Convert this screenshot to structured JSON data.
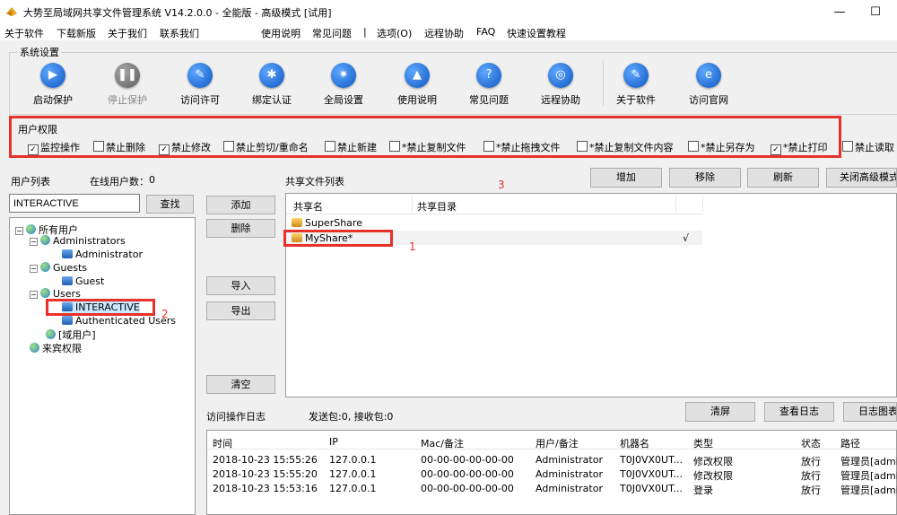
{
  "window": {
    "title": "大势至局域网共享文件管理系统 V14.2.0.0 - 全能版 - 高级模式 [试用]",
    "minimize": "—",
    "maximize": "☐"
  },
  "menu": {
    "about_software": "关于软件",
    "download": "下载新版",
    "about_us": "关于我们",
    "contact": "联系我们",
    "usage": "使用说明",
    "faq_cn": "常见问题",
    "separator": "|",
    "options": "选项(O)",
    "remote": "远程协助",
    "faq": "FAQ",
    "quick_setup": "快速设置教程"
  },
  "system_settings": {
    "label": "系统设置",
    "buttons": [
      {
        "label": "启动保护",
        "icon": "play-icon",
        "glyph": "▶"
      },
      {
        "label": "停止保护",
        "icon": "pause-icon",
        "glyph": "❚❚"
      },
      {
        "label": "访问许可",
        "icon": "key-icon",
        "glyph": "✎"
      },
      {
        "label": "绑定认证",
        "icon": "bind-icon",
        "glyph": "✱"
      },
      {
        "label": "全局设置",
        "icon": "gear-icon",
        "glyph": "✷"
      },
      {
        "label": "使用说明",
        "icon": "graduation-cap-icon",
        "glyph": "▲"
      },
      {
        "label": "常见问题",
        "icon": "question-icon",
        "glyph": "?"
      },
      {
        "label": "远程协助",
        "icon": "remote-globe-icon",
        "glyph": "◎"
      },
      {
        "label": "关于软件",
        "icon": "about-icon",
        "glyph": "✎"
      },
      {
        "label": "访问官网",
        "icon": "ie-icon",
        "glyph": "e"
      }
    ]
  },
  "permissions": {
    "label": "用户权限",
    "items": [
      {
        "label": "监控操作",
        "checked": true
      },
      {
        "label": "禁止删除",
        "checked": false
      },
      {
        "label": "禁止修改",
        "checked": true
      },
      {
        "label": "禁止剪切/重命名",
        "checked": false
      },
      {
        "label": "禁止新建",
        "checked": false
      },
      {
        "label": "*禁止复制文件",
        "checked": false
      },
      {
        "label": "*禁止拖拽文件",
        "checked": false
      },
      {
        "label": "*禁止复制文件内容",
        "checked": false
      },
      {
        "label": "*禁止另存为",
        "checked": false
      },
      {
        "label": "*禁止打印",
        "checked": true
      },
      {
        "label": "禁止读取",
        "checked": false
      }
    ]
  },
  "user_list": {
    "title": "用户列表",
    "online_label": "在线用户数：",
    "online_count": "0",
    "search_value": "INTERACTIVE",
    "find_button": "查找",
    "tree": {
      "root": "所有用户",
      "administrators": "Administrators",
      "administrator": "Administrator",
      "guests": "Guests",
      "guest": "Guest",
      "users": "Users",
      "interactive": "INTERACTIVE",
      "authenticated": "Authenticated Users",
      "domain": "[域用户]",
      "guests_perm": "来宾权限"
    }
  },
  "middle_buttons": {
    "add": "添加",
    "delete": "删除",
    "import": "导入",
    "export": "导出",
    "clear": "清空"
  },
  "share_list": {
    "title": "共享文件列表",
    "add": "增加",
    "remove": "移除",
    "refresh": "刷新",
    "close_advanced": "关闭高级模式",
    "col_name": "共享名",
    "col_dir": "共享目录",
    "rows": [
      {
        "name": "SuperShare",
        "dir": "",
        "check": ""
      },
      {
        "name": "MyShare*",
        "dir": "",
        "check": "√"
      }
    ]
  },
  "annotations": {
    "one": "1",
    "two": "2",
    "three": "3"
  },
  "log": {
    "title": "访问操作日志",
    "stats": "发送包:0, 接收包:0",
    "clear_screen": "清屏",
    "view_log": "查看日志",
    "log_chart": "日志图表",
    "columns": [
      "时间",
      "IP",
      "Mac/备注",
      "用户/备注",
      "机器名",
      "类型",
      "状态",
      "路径"
    ],
    "rows": [
      [
        "2018-10-23 15:55:26",
        "127.0.0.1",
        "00-00-00-00-00-00",
        "Administrator",
        "T0J0VX0UT...",
        "修改权限",
        "放行",
        "管理员[admin]"
      ],
      [
        "2018-10-23 15:55:20",
        "127.0.0.1",
        "00-00-00-00-00-00",
        "Administrator",
        "T0J0VX0UT...",
        "修改权限",
        "放行",
        "管理员[admin]"
      ],
      [
        "2018-10-23 15:53:16",
        "127.0.0.1",
        "00-00-00-00-00-00",
        "Administrator",
        "T0J0VX0UT...",
        "登录",
        "放行",
        "管理员[admin]"
      ]
    ]
  },
  "colors": {
    "accent_red": "#e8312a",
    "icon_blue": "#0d56c2"
  }
}
